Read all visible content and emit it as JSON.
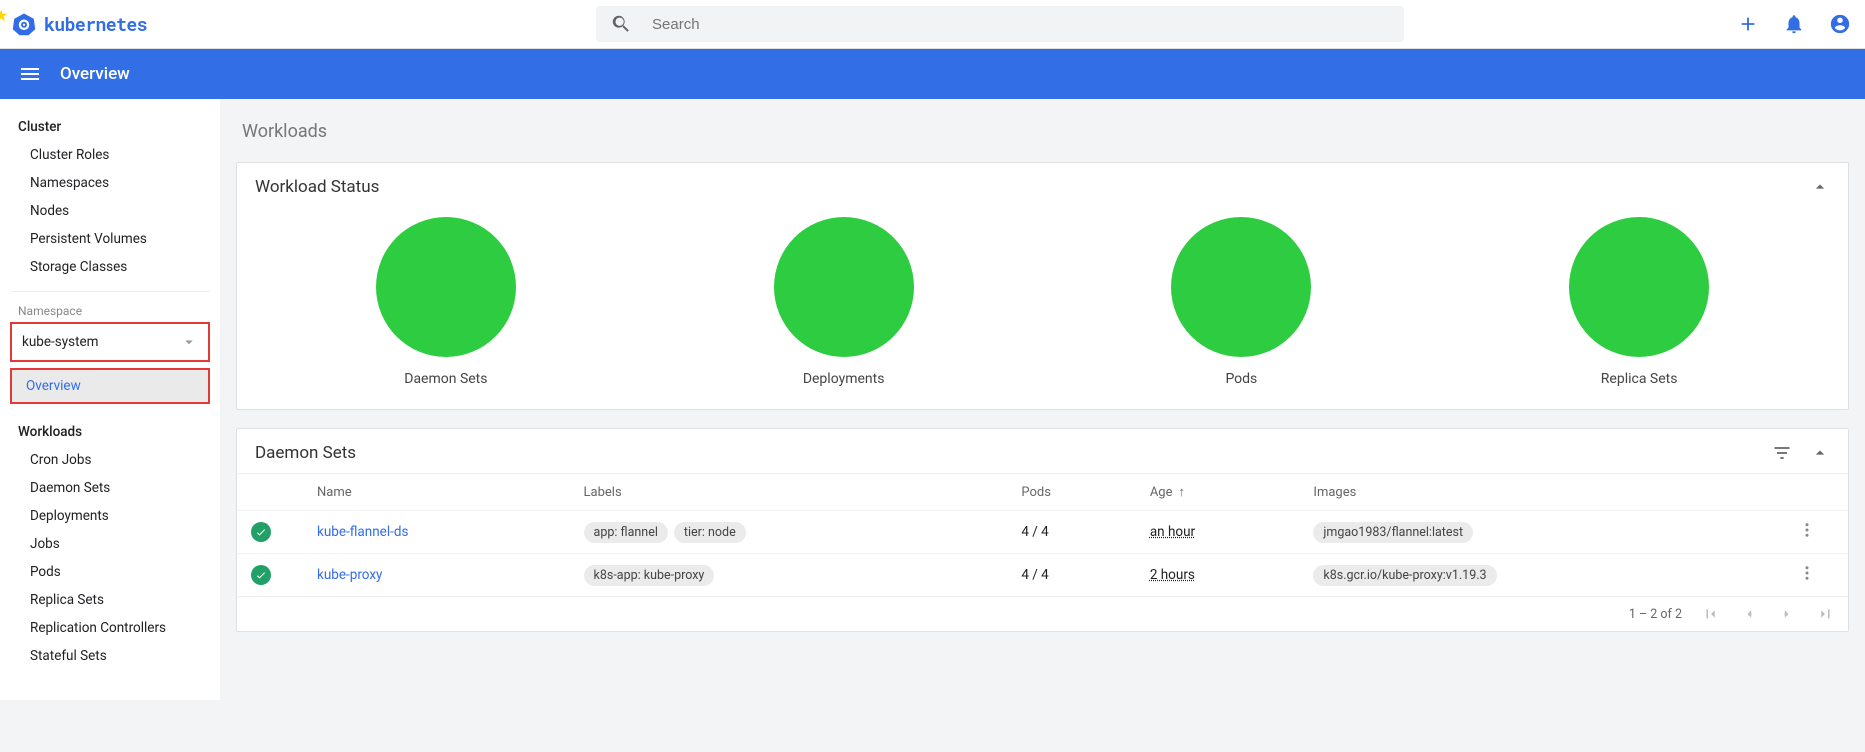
{
  "app": {
    "title": "kubernetes"
  },
  "search": {
    "placeholder": "Search"
  },
  "bluebar": {
    "title": "Overview"
  },
  "sidebar": {
    "cluster": {
      "title": "Cluster",
      "items": [
        "Cluster Roles",
        "Namespaces",
        "Nodes",
        "Persistent Volumes",
        "Storage Classes"
      ]
    },
    "namespace_label": "Namespace",
    "namespace_value": "kube-system",
    "overview_label": "Overview",
    "workloads": {
      "title": "Workloads",
      "items": [
        "Cron Jobs",
        "Daemon Sets",
        "Deployments",
        "Jobs",
        "Pods",
        "Replica Sets",
        "Replication Controllers",
        "Stateful Sets"
      ]
    }
  },
  "main": {
    "section_title": "Workloads",
    "workload_status": {
      "title": "Workload Status",
      "charts": [
        "Daemon Sets",
        "Deployments",
        "Pods",
        "Replica Sets"
      ]
    },
    "daemon_sets": {
      "title": "Daemon Sets",
      "columns": {
        "name": "Name",
        "labels": "Labels",
        "pods": "Pods",
        "age": "Age",
        "images": "Images"
      },
      "rows": [
        {
          "name": "kube-flannel-ds",
          "labels": [
            "app: flannel",
            "tier: node"
          ],
          "pods": "4 / 4",
          "age": "an hour",
          "images": [
            "jmgao1983/flannel:latest"
          ]
        },
        {
          "name": "kube-proxy",
          "labels": [
            "k8s-app: kube-proxy"
          ],
          "pods": "4 / 4",
          "age": "2 hours",
          "images": [
            "k8s.gcr.io/kube-proxy:v1.19.3"
          ]
        }
      ],
      "pager": "1 – 2 of 2"
    }
  }
}
